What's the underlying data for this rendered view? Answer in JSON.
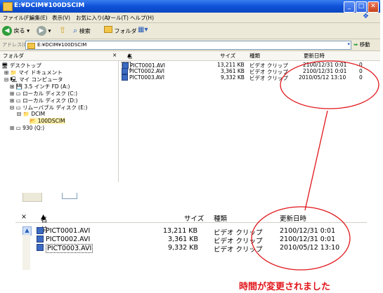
{
  "window": {
    "title": "E:¥DCIM¥100DSCIM",
    "menu": [
      "ファイル(F)",
      "編集(E)",
      "表示(V)",
      "お気に入り(A)",
      "ツール(T)",
      "ヘルプ(H)"
    ],
    "toolbar": {
      "back": "戻る",
      "search": "検索",
      "folders": "フォルダ"
    },
    "address_label": "アドレス(D)",
    "address_value": "E:¥DCIM¥100DSCIM",
    "go_label": "移動",
    "tree_header": "フォルダ",
    "columns": {
      "name": "名前",
      "size": "サイズ",
      "type": "種類",
      "modified": "更新日時"
    },
    "tree": [
      "デスクトップ",
      "マイ ドキュメント",
      "マイ コンピュータ",
      "3.5 インチ FD (A:)",
      "ローカル ディスク (C:)",
      "ローカル ディスク (D:)",
      "リムーバブル ディスク (E:)",
      "DCIM",
      "100DSCIM",
      "930 (Q:)"
    ],
    "files": [
      {
        "name": "PICT0001.AVI",
        "size": "13,211 KB",
        "type": "ビデオ クリップ",
        "modified": "2100/12/31 0:01",
        "extra": "0"
      },
      {
        "name": "PICT0002.AVI",
        "size": "3,361 KB",
        "type": "ビデオ クリップ",
        "modified": "2100/12/31 0:01",
        "extra": "0"
      },
      {
        "name": "PICT0003.AVI",
        "size": "9,332 KB",
        "type": "ビデオ クリップ",
        "modified": "2010/05/12 13:10",
        "extra": "0"
      }
    ]
  },
  "zoom": {
    "close_mark": "×",
    "columns": {
      "name": "名前",
      "size": "サイズ",
      "type": "種類",
      "modified": "更新日時"
    },
    "files": [
      {
        "name": "PICT0001.AVI",
        "size": "13,211 KB",
        "type": "ビデオ クリップ",
        "modified": "2100/12/31 0:01"
      },
      {
        "name": "PICT0002.AVI",
        "size": "3,361 KB",
        "type": "ビデオ クリップ",
        "modified": "2100/12/31 0:01"
      },
      {
        "name": "PICT0003.AVI",
        "size": "9,332 KB",
        "type": "ビデオ クリップ",
        "modified": "2010/05/12 13:10"
      }
    ]
  },
  "caption": "時間が変更されました",
  "colors": {
    "annotation": "#e0161b",
    "titlebar": "#0f52d8"
  }
}
